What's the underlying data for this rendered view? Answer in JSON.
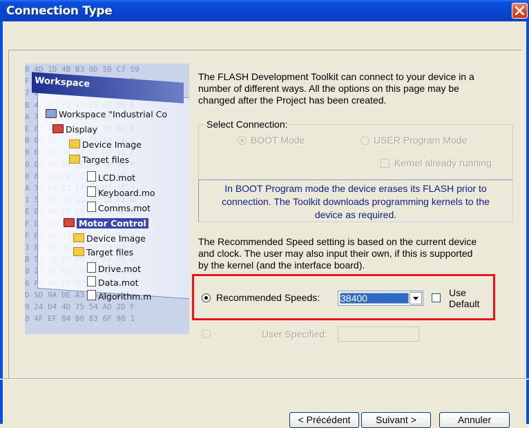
{
  "window": {
    "title": "Connection Type",
    "close_icon": "close-icon"
  },
  "illustration": {
    "workspace_title": "Workspace",
    "tree": [
      {
        "label": "Workspace \"Industrial Co",
        "icon": "workspace-icon"
      },
      {
        "label": "Display",
        "icon": "project-icon"
      },
      {
        "label": "Device Image",
        "icon": "folder-icon"
      },
      {
        "label": "Target files",
        "icon": "folder-icon"
      },
      {
        "label": "LCD.mot",
        "icon": "file-icon"
      },
      {
        "label": "Keyboard.mo",
        "icon": "file-icon"
      },
      {
        "label": "Comms.mot",
        "icon": "file-icon"
      },
      {
        "label": "Motor Control",
        "icon": "project-icon"
      },
      {
        "label": "Device Image",
        "icon": "folder-icon"
      },
      {
        "label": "Target files",
        "icon": "folder-icon"
      },
      {
        "label": "Drive.mot",
        "icon": "file-icon"
      },
      {
        "label": "Data.mot",
        "icon": "file-icon"
      },
      {
        "label": "Algorithm.m",
        "icon": "file-icon"
      }
    ]
  },
  "intro": {
    "line1": "The FLASH Development Toolkit can connect to your device in a",
    "line2": "number of different ways. All the options on this page may be",
    "line3": "changed after the Project has been created."
  },
  "select_connection": {
    "label": "Select Connection:",
    "boot_mode": "BOOT Mode",
    "user_mode": "USER Program Mode",
    "kernel_running": "Kernel already running",
    "selected": "BOOT Mode"
  },
  "info": {
    "line1": "In BOOT Program mode the device erases its FLASH prior to",
    "line2": "connection. The Toolkit downloads programming kernels to the",
    "line3": "device as required."
  },
  "speed_note": {
    "line1": "The Recommended Speed setting is based on the current device",
    "line2": "and clock. The user may also input their own, if this is supported",
    "line3": "by the kernel (and the interface board)."
  },
  "speed": {
    "recommended_label": "Recommended Speeds:",
    "recommended_value": "38400",
    "use_default_line1": "Use",
    "use_default_line2": "Default",
    "user_specified_label": "User Specified:",
    "user_specified_value": ""
  },
  "buttons": {
    "back": "< Précédent",
    "next": "Suivant >",
    "cancel": "Annuler"
  },
  "colors": {
    "titlebar": "#0a4fdb",
    "dialog_bg": "#ece9d8",
    "info_text": "#0e1e8c",
    "highlight": "#e8141b",
    "selection": "#316ac5"
  }
}
